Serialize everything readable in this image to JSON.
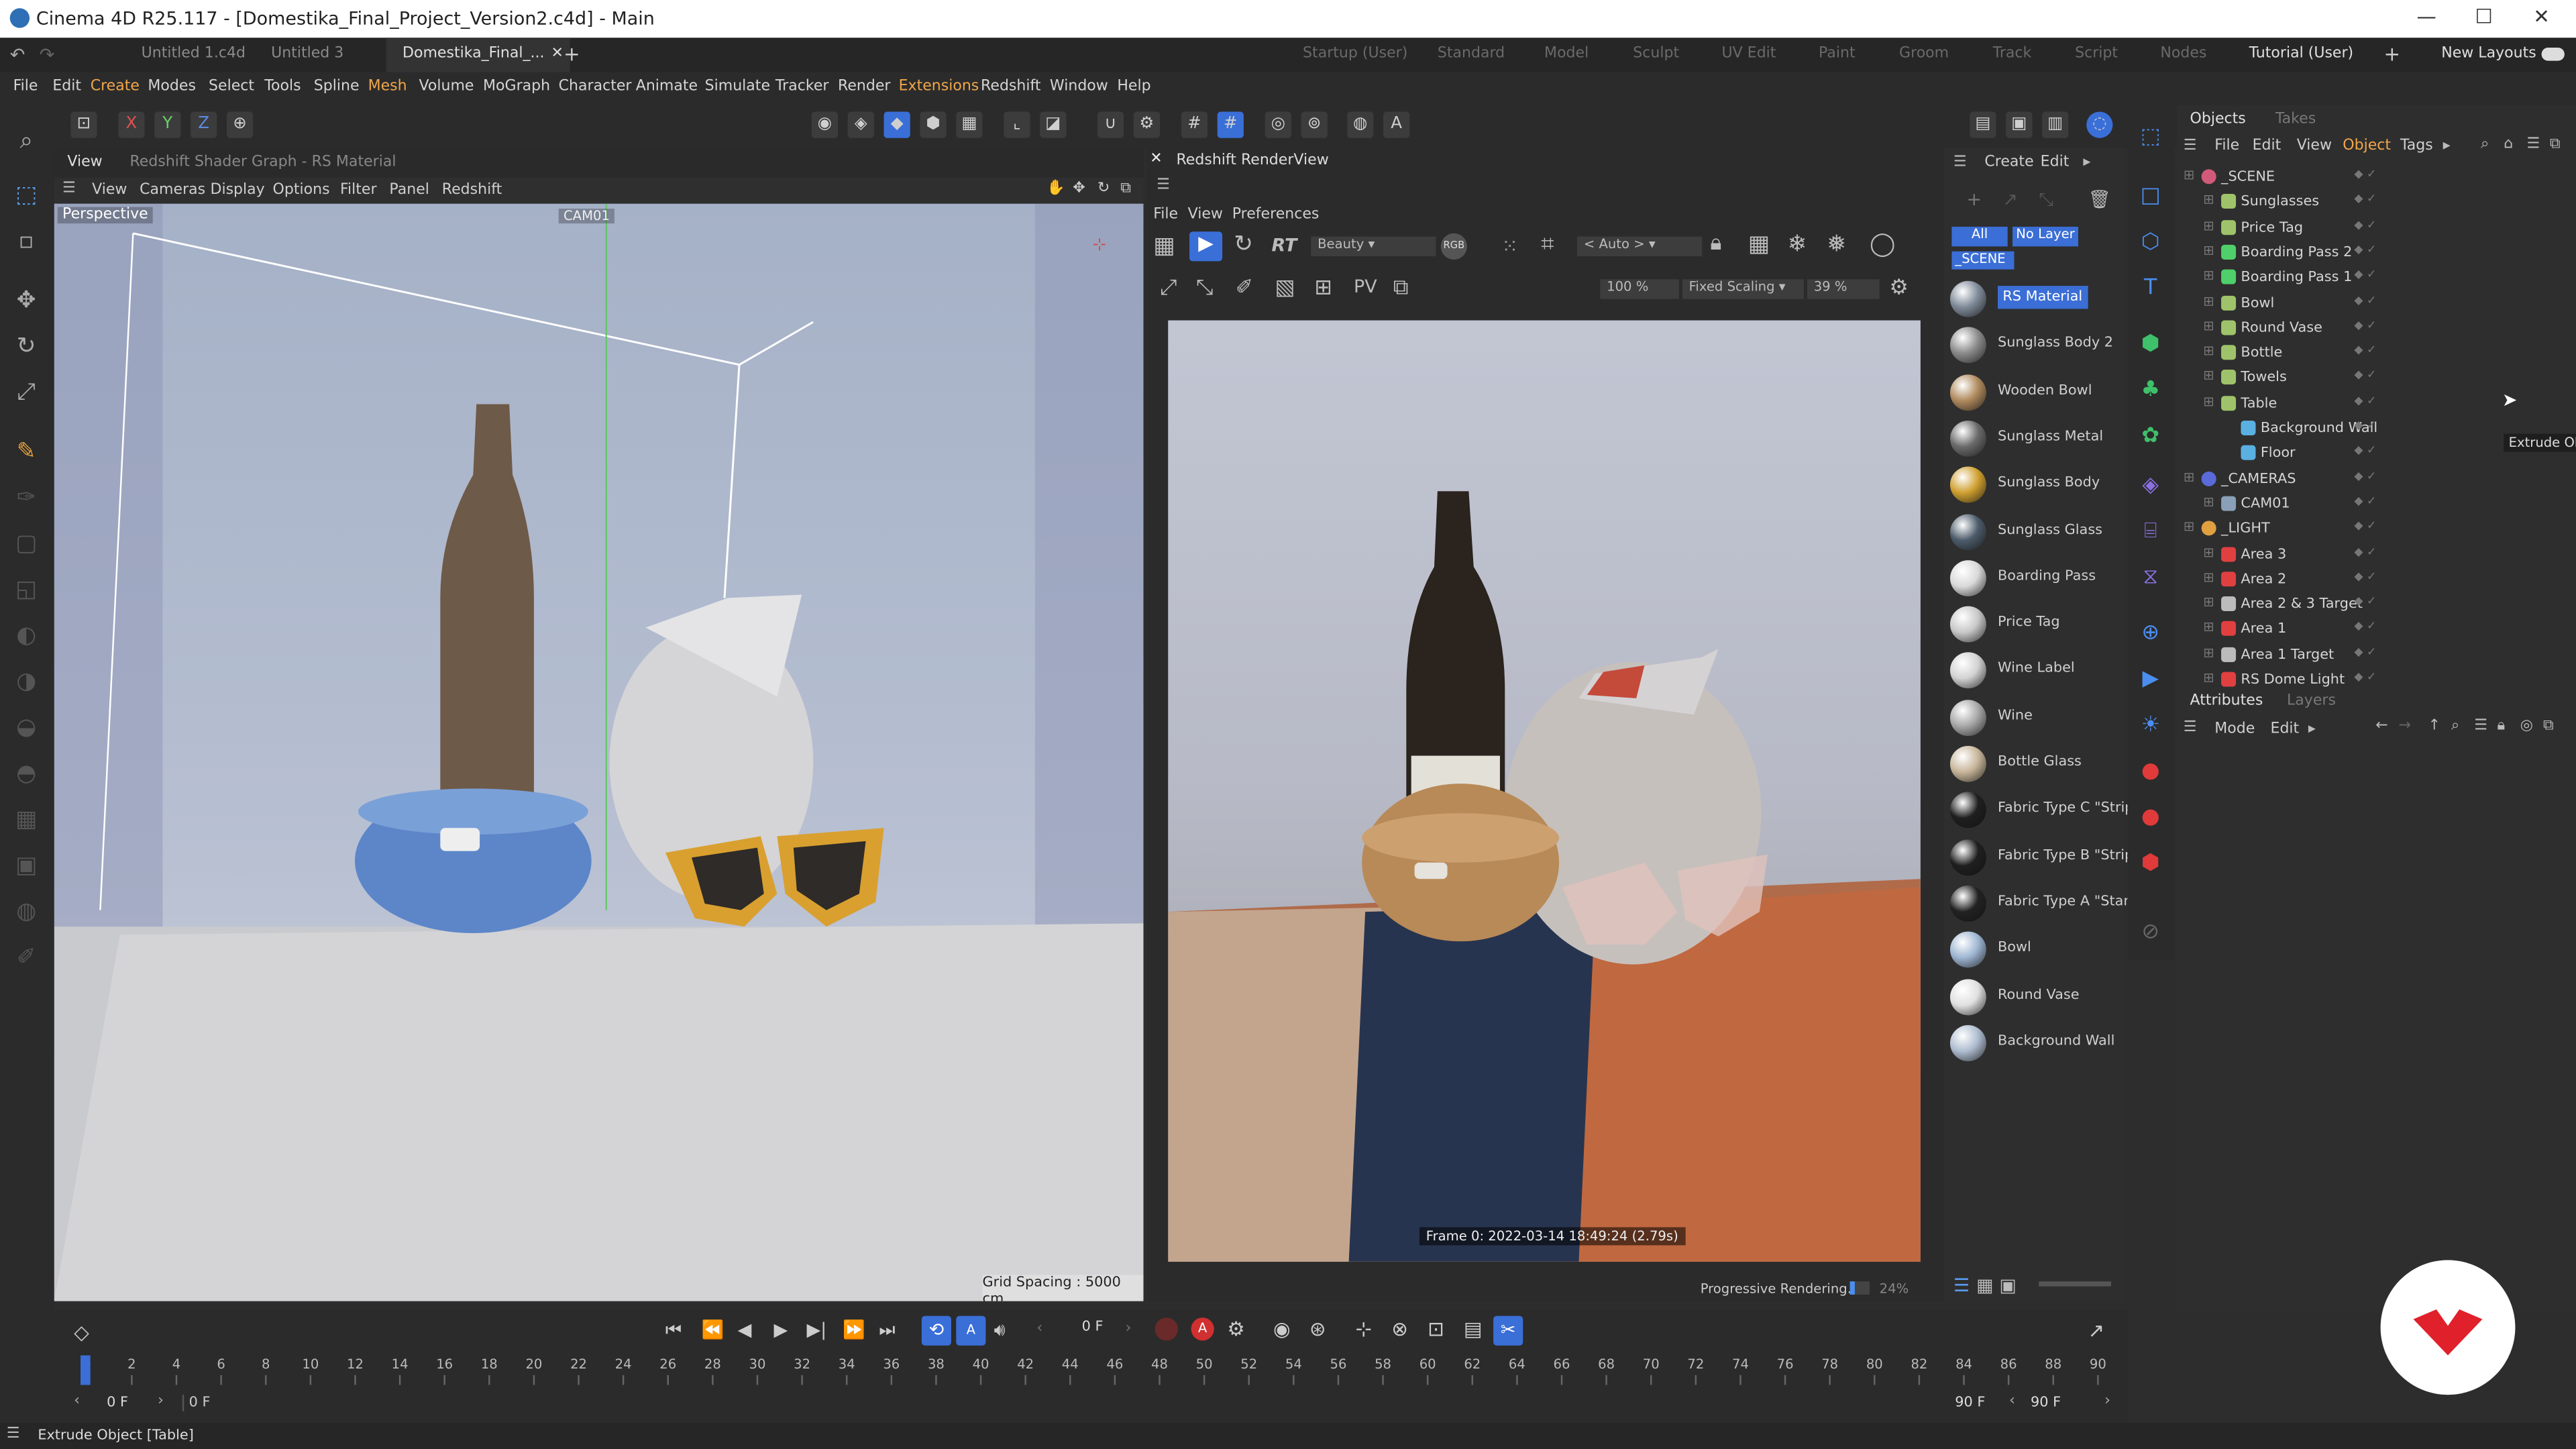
{
  "window": {
    "title": "Cinema 4D R25.117 - [Domestika_Final_Project_Version2.c4d] - Main",
    "controls": [
      "—",
      "☐",
      "✕"
    ]
  },
  "doc_tabs": [
    {
      "label": "Untitled 1.c4d",
      "active": false
    },
    {
      "label": "Untitled 3",
      "active": false
    },
    {
      "label": "Domestika_Final_...",
      "active": true
    }
  ],
  "layouts": [
    "Startup (User)",
    "Standard",
    "Model",
    "Sculpt",
    "UV Edit",
    "Paint",
    "Groom",
    "Track",
    "Script",
    "Nodes",
    "Tutorial (User)"
  ],
  "active_layout": "Tutorial (User)",
  "new_layouts": "New Layouts",
  "menus": [
    "File",
    "Edit",
    "Create",
    "Modes",
    "Select",
    "Tools",
    "Spline",
    "Mesh",
    "Volume",
    "MoGraph",
    "Character",
    "Animate",
    "Simulate",
    "Tracker",
    "Render",
    "Extensions",
    "Redshift",
    "Window",
    "Help"
  ],
  "menus_highlight": [
    "Create",
    "Mesh",
    "Extensions"
  ],
  "viewport": {
    "view_tab": "View",
    "shader_graph": "Redshift Shader Graph - RS Material",
    "menu": [
      "View",
      "Cameras",
      "Display",
      "Options",
      "Filter",
      "Panel",
      "Redshift"
    ],
    "label": "Perspective",
    "camera_tag": "CAM01",
    "grid_spacing": "Grid Spacing : 5000 cm"
  },
  "renderview": {
    "title": "Redshift RenderView",
    "menu": [
      "File",
      "View",
      "Preferences"
    ],
    "aov": "Beauty",
    "auto": "< Auto >",
    "zoom": "100 %",
    "scaling": "Fixed Scaling",
    "percent": "39 %",
    "frame_info": "Frame  0:  2022-03-14  18:49:24  (2.79s)",
    "progress_label": "Progressive Rendering...",
    "progress_value": "24%",
    "progress": 0.24
  },
  "materials": {
    "create": "Create",
    "edit": "Edit",
    "filters": [
      "All",
      "No Layer"
    ],
    "scene_tag": "_SCENE",
    "items": [
      {
        "label": "RS Material",
        "color": "#7f8a99",
        "selected": true
      },
      {
        "label": "Sunglass Body 2",
        "color": "#8b8b8b"
      },
      {
        "label": "Wooden Bowl",
        "color": "#b08a5e"
      },
      {
        "label": "Sunglass Metal",
        "color": "#6a6a6a"
      },
      {
        "label": "Sunglass Body",
        "color": "#d0a030"
      },
      {
        "label": "Sunglass Glass",
        "color": "#4c5b6a"
      },
      {
        "label": "Boarding Pass",
        "color": "#d9d9d9"
      },
      {
        "label": "Price Tag",
        "color": "#c8c8c8"
      },
      {
        "label": "Wine Label",
        "color": "#d2d2d2"
      },
      {
        "label": "Wine",
        "color": "#a8a8a8"
      },
      {
        "label": "Bottle Glass",
        "color": "#c8b69a"
      },
      {
        "label": "Fabric Type C \"Strip",
        "color": "#1f1f1f"
      },
      {
        "label": "Fabric Type B \"Strip",
        "color": "#1f1f1f"
      },
      {
        "label": "Fabric Type A \"Stan",
        "color": "#222222"
      },
      {
        "label": "Bowl",
        "color": "#9eb6d2"
      },
      {
        "label": "Round Vase",
        "color": "#e0e0e0"
      },
      {
        "label": "Background Wall",
        "color": "#aebcd0"
      }
    ]
  },
  "objects": {
    "tabs": [
      "Objects",
      "Takes"
    ],
    "menu": [
      "File",
      "Edit",
      "View",
      "Object",
      "Tags"
    ],
    "active_menu": "Object",
    "tree": [
      {
        "name": "_SCENE",
        "depth": 0,
        "color": "#d05a7a"
      },
      {
        "name": "Sunglasses",
        "depth": 1,
        "color": "#9fc36a"
      },
      {
        "name": "Price Tag",
        "depth": 1,
        "color": "#9fc36a"
      },
      {
        "name": "Boarding Pass 2",
        "depth": 1,
        "color": "#4fd06a"
      },
      {
        "name": "Boarding Pass 1",
        "depth": 1,
        "color": "#4fd06a"
      },
      {
        "name": "Bowl",
        "depth": 1,
        "color": "#9fc36a"
      },
      {
        "name": "Round Vase",
        "depth": 1,
        "color": "#9fc36a"
      },
      {
        "name": "Bottle",
        "depth": 1,
        "color": "#9fc36a"
      },
      {
        "name": "Towels",
        "depth": 1,
        "color": "#9fc36a"
      },
      {
        "name": "Table",
        "depth": 1,
        "color": "#9fc36a"
      },
      {
        "name": "Background Wall",
        "depth": 2,
        "color": "#5ab0e0"
      },
      {
        "name": "Floor",
        "depth": 2,
        "color": "#5ab0e0"
      },
      {
        "name": "_CAMERAS",
        "depth": 0,
        "color": "#5a6ad8"
      },
      {
        "name": "CAM01",
        "depth": 1,
        "color": "#8aa0b8"
      },
      {
        "name": "_LIGHT",
        "depth": 0,
        "color": "#e0a040"
      },
      {
        "name": "Area 3",
        "depth": 1,
        "color": "#e04040"
      },
      {
        "name": "Area 2",
        "depth": 1,
        "color": "#e04040"
      },
      {
        "name": "Area 2 & 3 Target",
        "depth": 1,
        "color": "#bbbbbb"
      },
      {
        "name": "Area 1",
        "depth": 1,
        "color": "#e04040"
      },
      {
        "name": "Area 1 Target",
        "depth": 1,
        "color": "#bbbbbb"
      },
      {
        "name": "RS Dome Light",
        "depth": 1,
        "color": "#e04040"
      }
    ],
    "tooltip": "Extrude Ob"
  },
  "attributes": {
    "tabs": [
      "Attributes",
      "Layers"
    ],
    "menu": [
      "Mode",
      "Edit"
    ]
  },
  "timeline": {
    "current_frame": "0 F",
    "ticks": [
      "0",
      "2",
      "4",
      "6",
      "8",
      "10",
      "12",
      "14",
      "16",
      "18",
      "20",
      "22",
      "24",
      "26",
      "28",
      "30",
      "32",
      "34",
      "36",
      "38",
      "40",
      "42",
      "44",
      "46",
      "48",
      "50",
      "52",
      "54",
      "56",
      "58",
      "60",
      "62",
      "64",
      "66",
      "68",
      "70",
      "72",
      "74",
      "76",
      "78",
      "80",
      "82",
      "84",
      "86",
      "88",
      "90"
    ],
    "start": "0 F",
    "start2": "0 F",
    "end": "90 F",
    "end2": "90 F"
  },
  "status": "Extrude Object [Table]"
}
